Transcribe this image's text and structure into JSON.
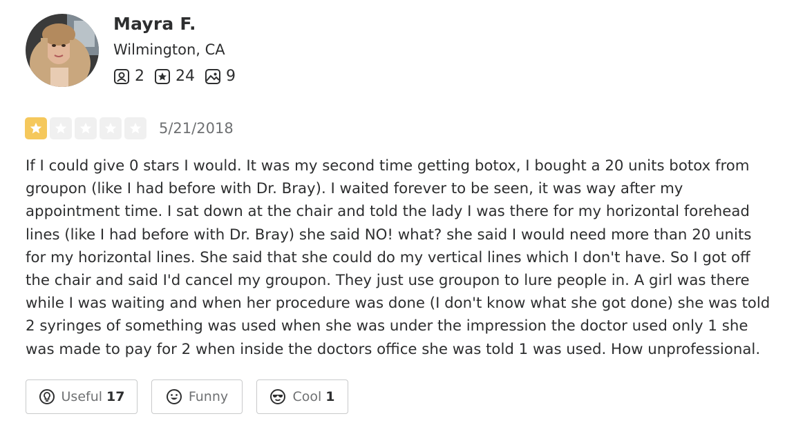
{
  "user": {
    "name": "Mayra F.",
    "location": "Wilmington, CA",
    "stats": {
      "friends": "2",
      "reviews": "24",
      "photos": "9"
    }
  },
  "review": {
    "rating": 1,
    "rating_max": 5,
    "date": "5/21/2018",
    "text_lines": [
      "If I could give 0 stars I would. It was my second time getting botox, I bought a 20 units botox from",
      "groupon (like I had before with Dr. Bray). I waited forever to be seen, it was way after my",
      "appointment time. I sat down at the chair and told the lady I was there for my horizontal forehead",
      "lines (like I had before with Dr. Bray) she said NO! what? she said I would need more than 20 units",
      "for my horizontal lines. She said that she could do my vertical lines which I don't have. So I got off",
      "the chair and said I'd cancel my groupon. They just use groupon to lure people in. A girl was there",
      "while I was waiting and when her procedure was done (I don't know what she got done) she was told",
      "2 syringes of something was used when she was under the impression the doctor used only 1 she",
      "was made to pay for 2 when inside the doctors office she was told 1 was used. How unprofessional."
    ]
  },
  "actions": {
    "useful": {
      "label": "Useful",
      "count": "17",
      "icon": "lightbulb-icon"
    },
    "funny": {
      "label": "Funny",
      "count": "",
      "icon": "smiley-icon"
    },
    "cool": {
      "label": "Cool",
      "count": "1",
      "icon": "sunglasses-icon"
    }
  },
  "colors": {
    "star_filled": "#f5c85c",
    "star_empty": "#f0f0f0",
    "text": "#2d2e2f",
    "muted": "#6e7072"
  }
}
